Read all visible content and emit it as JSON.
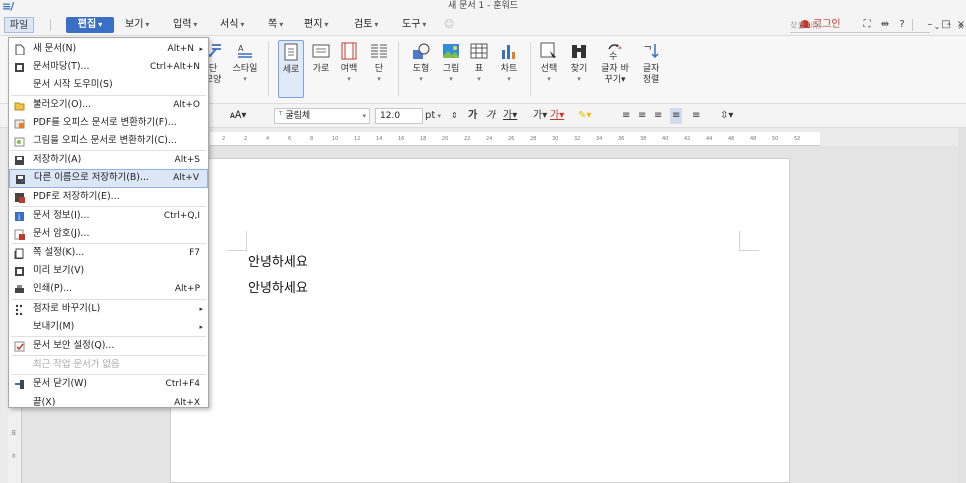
{
  "titlebar": {
    "title": "새 문서 1 - 훈워드",
    "logo": "≡/"
  },
  "menubar": {
    "file": "파일",
    "edit": "편집",
    "items": [
      {
        "label": "보기"
      },
      {
        "label": "입력"
      },
      {
        "label": "서식"
      },
      {
        "label": "쪽"
      },
      {
        "label": "편지"
      },
      {
        "label": "검토"
      },
      {
        "label": "도구"
      }
    ],
    "login": "로그인",
    "search_placeholder": "찾을 내용",
    "help": "?",
    "min": "–",
    "max": "□",
    "close": "×"
  },
  "ribbon": {
    "style_partial": "단",
    "style_partial2": "모양",
    "style": "스타일",
    "portrait": "세로",
    "landscape": "가로",
    "margin": "여백",
    "column": "단",
    "shape": "도형",
    "picture": "그림",
    "table": "표",
    "chart": "차트",
    "select": "선택",
    "find": "찾기",
    "replace": "글자",
    "replace2": "바꾸기",
    "sort": "글자",
    "sort2": "정렬"
  },
  "formatbar": {
    "font": "굴림체",
    "size": "12.0",
    "unit": "pt"
  },
  "ruler": {
    "ticks": [
      "2",
      "2",
      "4",
      "6",
      "8",
      "10",
      "12",
      "14",
      "16",
      "18",
      "20",
      "22",
      "24",
      "26",
      "28",
      "30",
      "32",
      "34",
      "36",
      "38",
      "40",
      "42",
      "44",
      "46",
      "48",
      "50",
      "52"
    ]
  },
  "left_ruler": [
    "표",
    "ㅎ"
  ],
  "document": {
    "lines": [
      "안녕하세요",
      "안녕하세요"
    ]
  },
  "file_menu": {
    "items": [
      {
        "label": "새 문서(N)",
        "shortcut": "Alt+N",
        "arrow": "▸",
        "icon": "new-document-icon"
      },
      {
        "label": "문서마당(T)...",
        "shortcut": "Ctrl+Alt+N",
        "icon": "template-icon"
      },
      {
        "label": "문서 시작 도우미(S)",
        "shortcut": "",
        "icon": ""
      },
      {
        "label": "불러오기(O)...",
        "shortcut": "Alt+O",
        "icon": "open-folder-icon"
      },
      {
        "label": "PDF를 오피스 문서로 변환하기(F)...",
        "shortcut": "",
        "icon": "pdf-convert-icon"
      },
      {
        "label": "그림을 오피스 문서로 변환하기(C)...",
        "shortcut": "",
        "icon": "image-convert-icon"
      },
      {
        "label": "저장하기(A)",
        "shortcut": "Alt+S",
        "icon": "save-icon"
      },
      {
        "label": "다른 이름으로 저장하기(B)...",
        "shortcut": "Alt+V",
        "icon": "save-as-icon"
      },
      {
        "label": "PDF로 저장하기(E)...",
        "shortcut": "",
        "icon": "pdf-save-icon"
      },
      {
        "label": "문서 정보(I)...",
        "shortcut": "Ctrl+Q,I",
        "icon": "info-icon"
      },
      {
        "label": "문서 암호(J)...",
        "shortcut": "",
        "icon": "lock-icon"
      },
      {
        "label": "쪽 설정(K)...",
        "shortcut": "F7",
        "icon": "page-setup-icon"
      },
      {
        "label": "미리 보기(V)",
        "shortcut": "",
        "icon": "preview-icon"
      },
      {
        "label": "인쇄(P)...",
        "shortcut": "Alt+P",
        "icon": "print-icon"
      },
      {
        "label": "점자로 바꾸기(L)",
        "shortcut": "",
        "arrow": "▸",
        "icon": "braille-icon"
      },
      {
        "label": "보내기(M)",
        "shortcut": "",
        "arrow": "▸",
        "icon": ""
      },
      {
        "label": "문서 보안 설정(Q)...",
        "shortcut": "",
        "icon": "security-icon"
      },
      {
        "label": "최근 작업 문서가 없음",
        "shortcut": "",
        "icon": ""
      },
      {
        "label": "문서 닫기(W)",
        "shortcut": "Ctrl+F4",
        "icon": "close-doc-icon"
      },
      {
        "label": "끝(X)",
        "shortcut": "Alt+X",
        "icon": ""
      }
    ]
  },
  "colors": {
    "accent": "#3b6fc6",
    "highlight": "#dbe6f6",
    "login": "#c0392b"
  }
}
